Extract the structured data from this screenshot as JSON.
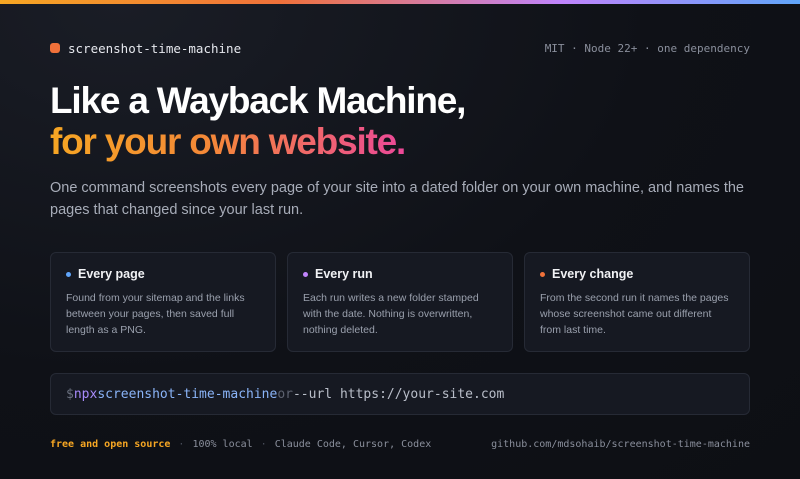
{
  "colors": {
    "accent_orange": "#f0713a",
    "accent_amber": "#f6a623",
    "accent_pink": "#ec4899",
    "accent_purple": "#c084fc",
    "accent_blue": "#60a5fa",
    "background": "#0f1117"
  },
  "header": {
    "brand_icon": "square-dot-icon",
    "brand_name": "screenshot-time-machine",
    "meta": "MIT · Node 22+ · one dependency"
  },
  "hero": {
    "line1": "Like a Wayback Machine,",
    "line2": "for your own website.",
    "lede": "One command screenshots every page of your site into a dated folder on your own machine, and names the pages that changed since your last run."
  },
  "cards": [
    {
      "title": "Every page",
      "dot_color": "#60a5fa",
      "body": "Found from your sitemap and the links between your pages, then saved full length as a PNG."
    },
    {
      "title": "Every run",
      "dot_color": "#c084fc",
      "body": "Each run writes a new folder stamped with the date. Nothing is overwritten, nothing deleted."
    },
    {
      "title": "Every change",
      "dot_color": "#f0713a",
      "body": "From the second run it names the pages whose screenshot came out different from last time."
    }
  ],
  "command": {
    "prompt": "$",
    "npx": "npx",
    "package": "screenshot-time-machine",
    "or": "or",
    "flag": "--url https://your-site.com"
  },
  "footer": {
    "highlight": "free and open source",
    "local": "100% local",
    "tools": "Claude Code, Cursor, Codex",
    "separator": "·",
    "repo": "github.com/mdsohaib/screenshot-time-machine"
  }
}
